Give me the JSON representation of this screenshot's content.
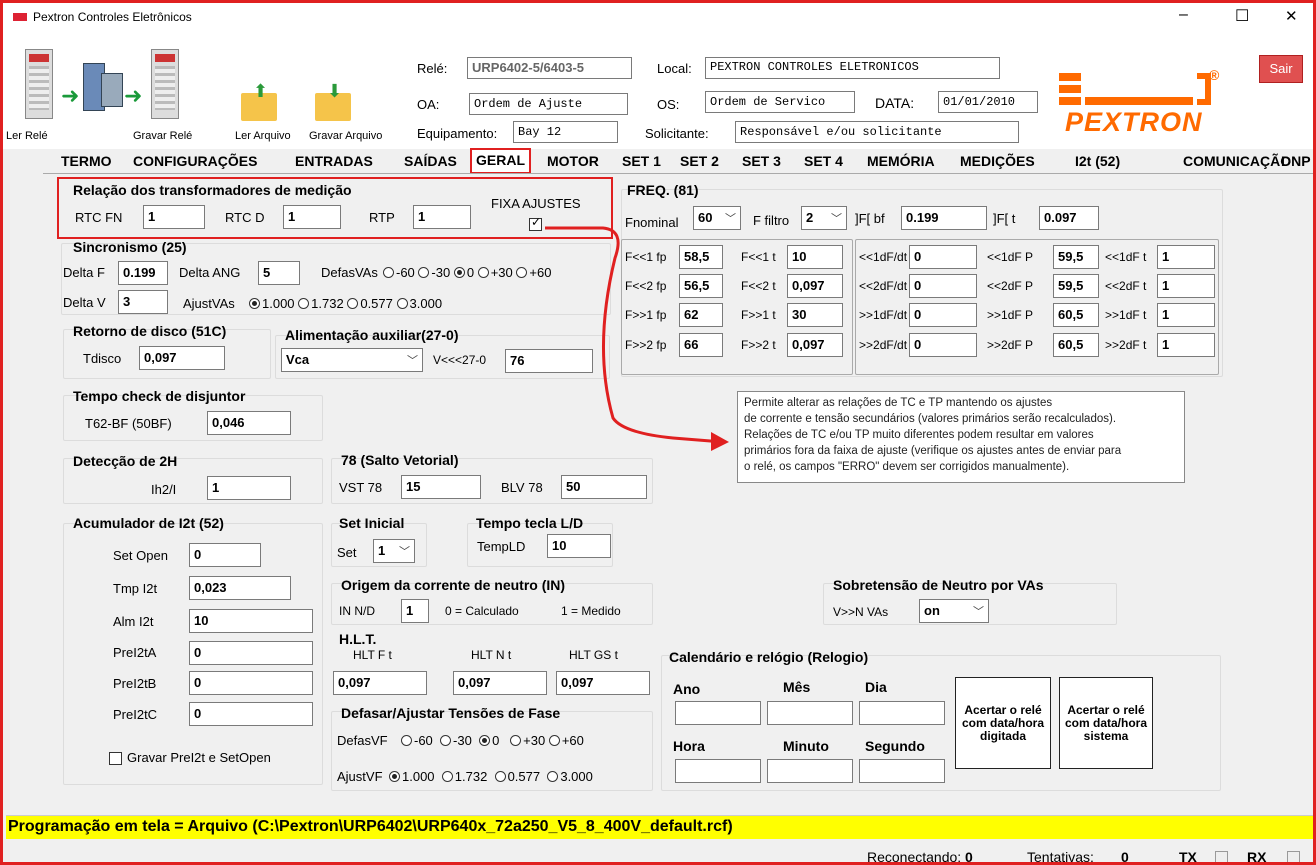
{
  "window": {
    "title": "Pextron Controles Eletrônicos",
    "min": "–",
    "max": "☐",
    "close": "✕"
  },
  "toolbar": {
    "ler_rele": "Ler Relé",
    "gravar_rele": "Gravar Relé",
    "ler_arquivo": "Ler Arquivo",
    "gravar_arquivo": "Gravar Arquivo"
  },
  "header": {
    "rele_label": "Relé:",
    "rele_value": "URP6402-5/6403-5",
    "local_label": "Local:",
    "local_value": "PEXTRON CONTROLES ELETRONICOS",
    "oa_label": "OA:",
    "oa_value": "Ordem de Ajuste",
    "os_label": "OS:",
    "os_value": "Ordem de Servico",
    "data_label": "DATA:",
    "data_value": "01/01/2010",
    "equip_label": "Equipamento:",
    "equip_value": "Bay 12",
    "solic_label": "Solicitante:",
    "solic_value": "Responsável e/ou solicitante",
    "sair": "Sair",
    "logo": "PEXTRON"
  },
  "tabs": [
    "TERMO",
    "CONFIGURAÇÕES",
    "ENTRADAS",
    "SAÍDAS",
    "GERAL",
    "MOTOR",
    "SET 1",
    "SET 2",
    "SET 3",
    "SET 4",
    "MEMÓRIA",
    "MEDIÇÕES",
    "I2t (52)",
    "COMUNICAÇÃO",
    "DNP"
  ],
  "relacao": {
    "title": "Relação dos transformadores de medição",
    "rtcfn_label": "RTC FN",
    "rtcfn": "1",
    "rtcd_label": "RTC D",
    "rtcd": "1",
    "rtp_label": "RTP",
    "rtp": "1",
    "fixa": "FIXA AJUSTES"
  },
  "sinc": {
    "title": "Sincronismo (25)",
    "deltaf_label": "Delta F",
    "deltaf": "0.199",
    "deltaang_label": "Delta ANG",
    "deltaang": "5",
    "defas_label": "DefasVAs",
    "defas_opts": [
      "-60",
      "-30",
      "0",
      "+30",
      "+60"
    ],
    "deltav_label": "Delta V",
    "deltav": "3",
    "ajust_label": "AjustVAs",
    "ajust_opts": [
      "1.000",
      "1.732",
      "0.577",
      "3.000"
    ]
  },
  "retorno": {
    "title": "Retorno de disco (51C)",
    "tdisco_label": "Tdisco",
    "tdisco": "0,097"
  },
  "alim": {
    "title": "Alimentação auxiliar(27-0)",
    "tipo": "Vca",
    "v_label": "V<<<27-0",
    "v": "76"
  },
  "tempo_check": {
    "title": "Tempo check de disjuntor",
    "label": "T62-BF (50BF)",
    "value": "0,046"
  },
  "deteccao": {
    "title": "Detecção de 2H",
    "label": "Ih2/I",
    "value": "1"
  },
  "salto": {
    "title": "78 (Salto Vetorial)",
    "vst_label": "VST 78",
    "vst": "15",
    "blv_label": "BLV 78",
    "blv": "50"
  },
  "acum": {
    "title": "Acumulador de I2t (52)",
    "set_open_label": "Set Open",
    "set_open": "0",
    "tmp_label": "Tmp I2t",
    "tmp": "0,023",
    "alm_label": "Alm I2t",
    "alm": "10",
    "a_label": "PreI2tA",
    "a": "0",
    "b_label": "PreI2tB",
    "b": "0",
    "c_label": "PreI2tC",
    "c": "0",
    "gravar": "Gravar PreI2t e SetOpen"
  },
  "set_inicial": {
    "title": "Set Inicial",
    "label": "Set",
    "value": "1"
  },
  "tecla": {
    "title": "Tempo tecla L/D",
    "label": "TempLD",
    "value": "10"
  },
  "origem": {
    "title": "Origem da corrente de neutro (IN)",
    "label": "IN N/D",
    "value": "1",
    "calc": "0 = Calculado",
    "med": "1 = Medido"
  },
  "sobre": {
    "title": "Sobretensão de Neutro por VAs",
    "label": "V>>N VAs",
    "value": "on"
  },
  "hlt": {
    "title": "H.L.T.",
    "f_label": "HLT F t",
    "f": "0,097",
    "n_label": "HLT N t",
    "n": "0,097",
    "gs_label": "HLT GS t",
    "gs": "0,097"
  },
  "defasar": {
    "title": "Defasar/Ajustar Tensões de Fase",
    "defas_label": "DefasVF",
    "defas_opts": [
      "-60",
      "-30",
      "0",
      "+30",
      "+60"
    ],
    "ajust_label": "AjustVF",
    "ajust_opts": [
      "1.000",
      "1.732",
      "0.577",
      "3.000"
    ]
  },
  "cal": {
    "title": "Calendário e relógio (Relogio)",
    "ano": "Ano",
    "mes": "Mês",
    "dia": "Dia",
    "hora": "Hora",
    "minuto": "Minuto",
    "segundo": "Segundo",
    "btn1": "Acertar o relé com data/hora digitada",
    "btn2": "Acertar o relé com data/hora sistema"
  },
  "freq": {
    "title": "FREQ. (81)",
    "fnom_label": "Fnominal",
    "fnom": "60",
    "ffiltro_label": "F filtro",
    "ffiltro": "2",
    "bf_label": "]F[ bf",
    "bf": "0.199",
    "t_label": "]F[ t",
    "t": "0.097",
    "left": [
      [
        "F<<1 fp",
        "58,5",
        "F<<1 t",
        "10"
      ],
      [
        "F<<2 fp",
        "56,5",
        "F<<2 t",
        "0,097"
      ],
      [
        "F>>1 fp",
        "62",
        "F>>1 t",
        "30"
      ],
      [
        "F>>2 fp",
        "66",
        "F>>2 t",
        "0,097"
      ]
    ],
    "right": [
      [
        "<<1dF/dt",
        "0",
        "<<1dF P",
        "59,5",
        "<<1dF t",
        "1"
      ],
      [
        "<<2dF/dt",
        "0",
        "<<2dF P",
        "59,5",
        "<<2dF t",
        "1"
      ],
      [
        ">>1dF/dt",
        "0",
        ">>1dF P",
        "60,5",
        ">>1dF t",
        "1"
      ],
      [
        ">>2dF/dt",
        "0",
        ">>2dF P",
        "60,5",
        ">>2dF t",
        "1"
      ]
    ]
  },
  "tooltip": [
    "Permite alterar as relações de TC e TP mantendo os ajustes",
    "de corrente e tensão secundários (valores primários serão recalculados).",
    "Relações de TC e/ou TP muito diferentes podem resultar em valores",
    "primários fora da faixa de ajuste (verifique os ajustes antes de enviar para",
    "o relé, os campos \"ERRO\" devem ser corrigidos manualmente)."
  ],
  "status": {
    "programacao": "Programação em tela = Arquivo (C:\\Pextron\\URP6402\\URP640x_72a250_V5_8_400V_default.rcf)",
    "reconectando_label": "Reconectando:",
    "reconectando": "0",
    "tentativas_label": "Tentativas:",
    "tentativas": "0",
    "tx": "TX",
    "rx": "RX"
  }
}
